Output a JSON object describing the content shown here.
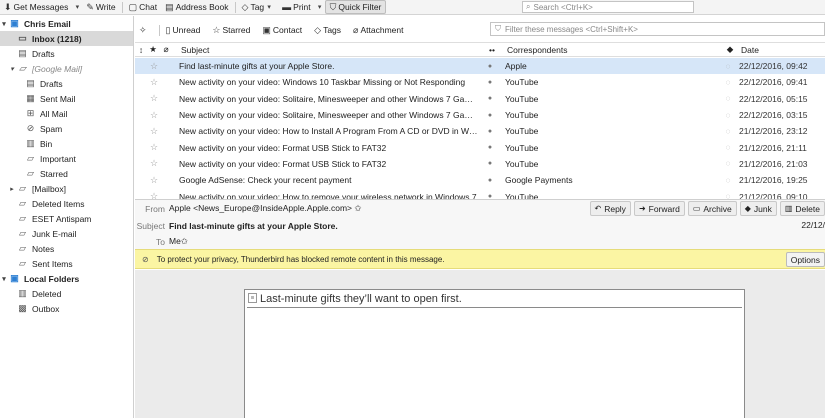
{
  "toolbar": {
    "get_messages": "Get Messages",
    "write": "Write",
    "chat": "Chat",
    "address_book": "Address Book",
    "tag": "Tag",
    "print": "Print",
    "quick_filter": "Quick Filter",
    "search_placeholder": "Search <Ctrl+K>"
  },
  "folders": [
    {
      "label": "Chris Email",
      "kind": "account",
      "twisty": "▾"
    },
    {
      "label": "Inbox (1218)",
      "kind": "selected",
      "icon": "inbox-icon"
    },
    {
      "label": "Drafts",
      "kind": "normal",
      "icon": "drafts-icon"
    },
    {
      "label": "[Google Mail]",
      "kind": "muted",
      "twisty": "▾"
    },
    {
      "label": "Drafts",
      "kind": "normal",
      "icon": "drafts-icon"
    },
    {
      "label": "Sent Mail",
      "kind": "normal",
      "icon": "sent-icon"
    },
    {
      "label": "All Mail",
      "kind": "normal",
      "icon": "allmail-icon"
    },
    {
      "label": "Spam",
      "kind": "normal",
      "icon": "spam-icon"
    },
    {
      "label": "Bin",
      "kind": "normal",
      "icon": "bin-icon"
    },
    {
      "label": "Important",
      "kind": "normal",
      "icon": "folder-icon"
    },
    {
      "label": "Starred",
      "kind": "normal",
      "icon": "folder-icon"
    },
    {
      "label": "[Mailbox]",
      "kind": "normal",
      "icon": "folder-icon",
      "twisty": "▸"
    },
    {
      "label": "Deleted Items",
      "kind": "normal",
      "icon": "folder-icon"
    },
    {
      "label": "ESET Antispam",
      "kind": "normal",
      "icon": "folder-icon"
    },
    {
      "label": "Junk E-mail",
      "kind": "normal",
      "icon": "folder-icon"
    },
    {
      "label": "Notes",
      "kind": "normal",
      "icon": "folder-icon"
    },
    {
      "label": "Sent Items",
      "kind": "normal",
      "icon": "folder-icon"
    },
    {
      "label": "Local Folders",
      "kind": "account",
      "twisty": "▾"
    },
    {
      "label": "Deleted",
      "kind": "normal",
      "icon": "bin-icon"
    },
    {
      "label": "Outbox",
      "kind": "normal",
      "icon": "outbox-icon"
    }
  ],
  "message_toolbar": {
    "unread": "Unread",
    "starred": "Starred",
    "contact": "Contact",
    "tags": "Tags",
    "attachment": "Attachment",
    "filter_placeholder": "Filter these messages <Ctrl+Shift+K>"
  },
  "columns": {
    "subject": "Subject",
    "correspondents": "Correspondents",
    "date": "Date"
  },
  "messages": [
    {
      "subject": "Find last-minute gifts at your Apple Store.",
      "from": "Apple",
      "date": "22/12/2016, 09:42",
      "selected": true
    },
    {
      "subject": "New activity on your video: Windows 10 Taskbar Missing or Not Responding",
      "from": "YouTube",
      "date": "22/12/2016, 09:41"
    },
    {
      "subject": "New activity on your video: Solitaire, Minesweeper and other Windows 7 Games in ...",
      "from": "YouTube",
      "date": "22/12/2016, 05:15"
    },
    {
      "subject": "New activity on your video: Solitaire, Minesweeper and other Windows 7 Games in ...",
      "from": "YouTube",
      "date": "22/12/2016, 03:15"
    },
    {
      "subject": "New activity on your video: How to Install A Program From A CD or DVD in Windows",
      "from": "YouTube",
      "date": "21/12/2016, 23:12"
    },
    {
      "subject": "New activity on your video: Format USB Stick to FAT32",
      "from": "YouTube",
      "date": "21/12/2016, 21:11"
    },
    {
      "subject": "New activity on your video: Format USB Stick to FAT32",
      "from": "YouTube",
      "date": "21/12/2016, 21:03"
    },
    {
      "subject": "Google AdSense: Check your recent payment",
      "from": "Google Payments",
      "date": "21/12/2016, 19:25"
    },
    {
      "subject": "New activity on your video: How to remove your wireless network in Windows 7",
      "from": "YouTube",
      "date": "21/12/2016, 09:10"
    }
  ],
  "header": {
    "from_label": "From",
    "from_value": "Apple <News_Europe@InsideApple.Apple.com> ✩",
    "subject_label": "Subject",
    "subject_value": "Find last-minute gifts at your Apple Store.",
    "to_label": "To",
    "to_value": "Me✩",
    "date_value": "22/12/",
    "reply": "Reply",
    "forward": "Forward",
    "archive": "Archive",
    "junk": "Junk",
    "delete": "Delete"
  },
  "notice": {
    "text": "To protect your privacy, Thunderbird has blocked remote content in this message.",
    "options": "Options"
  },
  "body": {
    "alt_text": "Last-minute gifts they’ll want to open first."
  }
}
